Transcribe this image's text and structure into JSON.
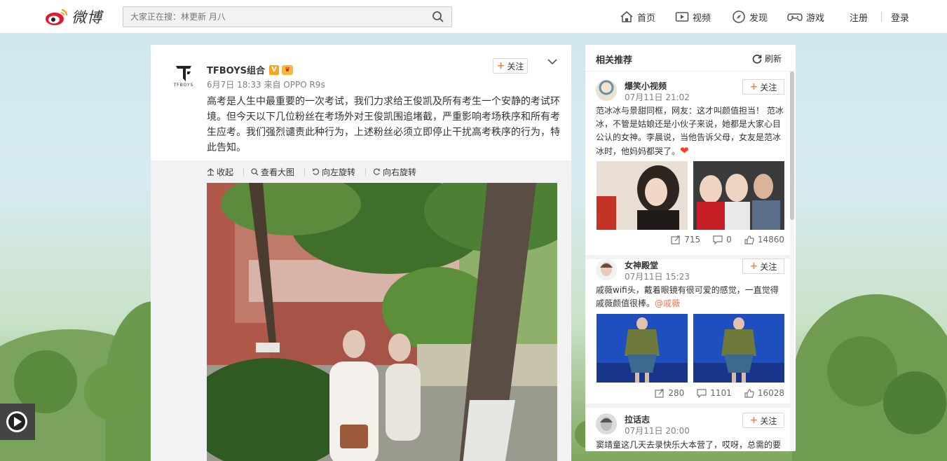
{
  "header": {
    "logo_text": "微博",
    "search_placeholder": "大家正在搜：林更新 月八",
    "nav": [
      {
        "label": "首页",
        "icon": "home-icon"
      },
      {
        "label": "视频",
        "icon": "video-icon"
      },
      {
        "label": "发现",
        "icon": "compass-icon"
      },
      {
        "label": "游戏",
        "icon": "gamepad-icon"
      }
    ],
    "register": "注册",
    "login": "登录"
  },
  "post": {
    "author": "TFBOYS组合",
    "avatar_text": "TFBOYS",
    "verified_badge": "V",
    "meta": "6月7日 18:33 来自 OPPO R9s",
    "follow_label": "关注",
    "text": "高考是人生中最重要的一次考试，我们力求给王俊凯及所有考生一个安静的考试环境。但今天以下几位粉丝在考场外对王俊凯围追堵截，严重影响考场秩序和所有考生应考。我们强烈谴责此种行为，上述粉丝必须立即停止干扰高考秩序的行为，特此告知。",
    "image_tools": [
      "收起",
      "查看大图",
      "向左旋转",
      "向右旋转"
    ]
  },
  "sidebar": {
    "title": "相关推荐",
    "refresh_label": "刷新",
    "items": [
      {
        "name": "爆笑小视频",
        "time": "07月11日 21:02",
        "follow_label": "关注",
        "text": "范冰冰与景甜同框，网友：这才叫颜值担当！ 范冰冰，不管是姑娘还是小伙子来说，她都是大家心目公认的女神。李晨说，当他告诉父母，女友是范冰冰时，他妈妈都哭了。",
        "emoji": "❤",
        "reposts": "715",
        "comments": "0",
        "likes": "14860"
      },
      {
        "name": "女神殿堂",
        "time": "07月11日 15:23",
        "follow_label": "关注",
        "text": "戚薇wifi头，戴着眼镜有很可爱的感觉，一直觉得戚薇颜值很棒。",
        "mention": "@戚薇",
        "reposts": "280",
        "comments": "1101",
        "likes": "16028"
      },
      {
        "name": "拉话志",
        "time": "07月11日 20:00",
        "follow_label": "关注",
        "text": "窦靖童这几天去录快乐大本营了，哎呀，总需的要"
      }
    ]
  },
  "colors": {
    "accent": "#ff8140",
    "link": "#eb7350",
    "weibo_red": "#e6162d"
  }
}
